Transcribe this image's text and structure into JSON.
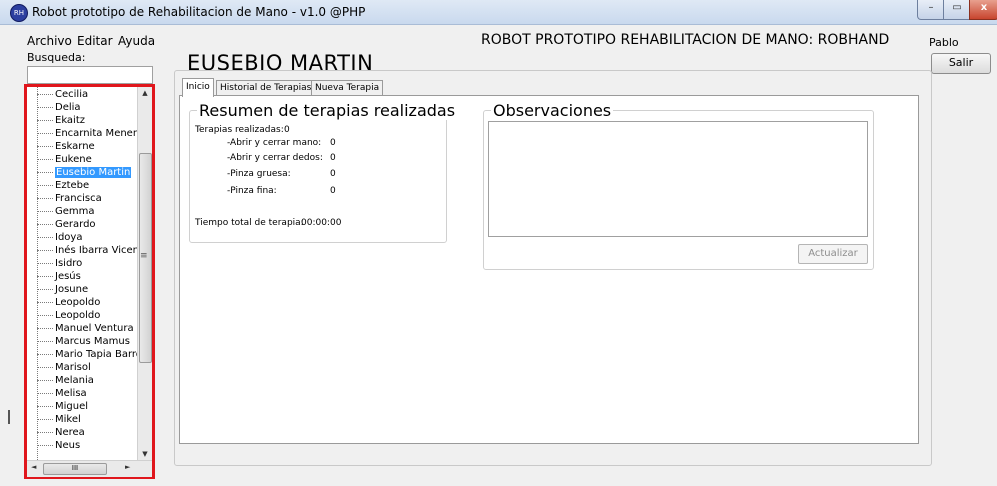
{
  "window": {
    "title": "Robot prototipo de Rehabilitacion de Mano - v1.0 @PHP",
    "icon_text": "RH",
    "controls": {
      "minimize": "–",
      "maximize": "▭",
      "close": "x"
    }
  },
  "menu": {
    "archivo": "Archivo",
    "editar": "Editar",
    "ayuda": "Ayuda"
  },
  "header": {
    "app_name": "ROBOT PROTOTIPO REHABILITACION DE MANO: ROBHAND",
    "user": "Pablo",
    "exit_label": "Salir"
  },
  "search": {
    "label": "Busqueda:",
    "value": ""
  },
  "patients": {
    "items": [
      "Cecilia",
      "Delia",
      "Ekaitz",
      "Encarnita Menend",
      "Eskarne",
      "Eukene",
      "Eusebio Martin",
      "Eztebe",
      "Francisca",
      "Gemma",
      "Gerardo",
      "Idoya",
      "Inés  Ibarra Vicent",
      "Isidro",
      "Jesús",
      "Josune",
      "Leopoldo",
      "Leopoldo",
      "Manuel Ventura M",
      "Marcus Mamus",
      "Mario Tapia Barros",
      "Marisol",
      "Melania",
      "Melisa",
      "Miguel",
      "Mikel",
      "Nerea",
      "Neus"
    ],
    "selected_index": 6,
    "scroll": {
      "up": "▲",
      "down": "▼",
      "left": "◄",
      "right": "►",
      "grip": "III",
      "mid_grip": "≡"
    }
  },
  "main": {
    "patient_name": "EUSEBIO MARTIN",
    "tabs": [
      "Inicio",
      "Historial de Terapias",
      "Nueva Terapia"
    ],
    "active_tab": 0
  },
  "summary": {
    "title": "Resumen de terapias realizadas",
    "total_label": "Terapias realizadas:",
    "total_value": "0",
    "rows": [
      {
        "label": "-Abrir y cerrar mano:",
        "value": "0"
      },
      {
        "label": "-Abrir y cerrar dedos:",
        "value": "0"
      },
      {
        "label": "-Pinza gruesa:",
        "value": "0"
      },
      {
        "label": "-Pinza fina:",
        "value": "0"
      }
    ],
    "time_label": "Tiempo total de terapia:",
    "time_value": "00:00:00"
  },
  "observations": {
    "title": "Observaciones",
    "text": "",
    "update_label": "Actualizar"
  }
}
